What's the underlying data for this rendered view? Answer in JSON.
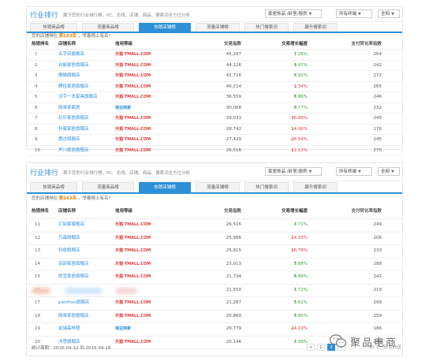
{
  "panel1": {
    "brand": "行业排行",
    "description": "属于您的行业排行榜，PC、无线、店铺、商品、搜索词全方位分析",
    "category_select": "家居饰品 /卧室/厨房",
    "terminal_select": "所有终端",
    "network_select": "全网",
    "tabs": [
      {
        "label": "热销商品榜"
      },
      {
        "label": "流量商品榜"
      },
      {
        "label": "热销店铺榜"
      },
      {
        "label": "流量店铺榜"
      },
      {
        "label": "热门搜索词"
      },
      {
        "label": "飙升搜索词"
      }
    ],
    "rank_line": {
      "prefix": "您的店铺排在",
      "value": "第163名",
      "suffix": "，举着榜上有名?"
    },
    "columns": {
      "rank": "热销排名",
      "shop": "店铺名称",
      "credit": "信用等级",
      "trade": "交易指数",
      "growth": "交易增长幅度",
      "conversion": "支付转化率指数"
    },
    "rows": [
      {
        "rank": "1",
        "shop": "名字店旗舰店",
        "credit": "天猫 TMALL.COM",
        "trade": "45,297",
        "dir": "up",
        "growth": "7.26%",
        "conv": "264"
      },
      {
        "rank": "2",
        "shop": "台能家居旗舰店",
        "credit": "天猫 TMALL.COM",
        "trade": "44,126",
        "dir": "up",
        "growth": "9.97%",
        "conv": "242"
      },
      {
        "rank": "3",
        "shop": "懒猫旗舰店",
        "credit": "天猫 TMALL.COM",
        "trade": "42,716",
        "dir": "up",
        "growth": "0.91%",
        "conv": "272"
      },
      {
        "rank": "4",
        "shop": "腾佳家居旗舰店",
        "credit": "天猫 TMALL.COM",
        "trade": "40,214",
        "dir": "down",
        "growth": "2.34%",
        "conv": "265"
      },
      {
        "rank": "5",
        "shop": "沃宇一本家具旗舰店",
        "credit": "天猫 TMALL.COM",
        "trade": "36,559",
        "dir": "up",
        "growth": "6.86%",
        "conv": "246"
      },
      {
        "rank": "6",
        "shop": "简单家家居",
        "credit": "淘宝商家",
        "trade": "30,068",
        "dir": "up",
        "growth": "0.77%",
        "conv": "232"
      },
      {
        "rank": "7",
        "shop": "幻乐家居旗舰店",
        "credit": "天猫 TMALL.COM",
        "trade": "29,033",
        "dir": "down",
        "growth": "36.88%",
        "conv": "249"
      },
      {
        "rank": "8",
        "shop": "科曼家居旗舰店",
        "credit": "天猫 TMALL.COM",
        "trade": "28,742",
        "dir": "down",
        "growth": "14.06%",
        "conv": "176"
      },
      {
        "rank": "9",
        "shop": "惠达旗舰店",
        "credit": "天猫 TMALL.COM",
        "trade": "27,429",
        "dir": "down",
        "growth": "26.54%",
        "conv": "245"
      },
      {
        "rank": "10",
        "shop": "声川家居旗舰店",
        "credit": "天猫 TMALL.COM",
        "trade": "26,516",
        "dir": "down",
        "growth": "12.13%",
        "conv": "270"
      }
    ]
  },
  "panel2": {
    "brand": "行业排行",
    "description": "属于您的行业排行榜，PC、无线、店铺、商品、搜索词全方位分析",
    "category_select": "家居饰品 /卧室/厨房",
    "terminal_select": "所有终端",
    "network_select": "全网",
    "tabs": [
      {
        "label": "热销商品榜"
      },
      {
        "label": "流量商品榜"
      },
      {
        "label": "热销店铺榜"
      },
      {
        "label": "流量店铺榜"
      },
      {
        "label": "热门搜索词"
      },
      {
        "label": "飙升搜索词"
      }
    ],
    "rank_line": {
      "prefix": "您的店铺排在",
      "value": "第163名",
      "suffix": "，举着榜上有名?"
    },
    "columns": {
      "rank": "热销排名",
      "shop": "店铺名称",
      "credit": "信用等级",
      "trade": "交易指数",
      "growth": "交易增长幅度",
      "conversion": "支付转化率指数"
    },
    "rows": [
      {
        "rank": "11",
        "shop": "汇如家旗舰店",
        "credit": "天猫 TMALL.COM",
        "trade": "26,516",
        "dir": "up",
        "growth": "2.71%",
        "conv": "249"
      },
      {
        "rank": "12",
        "shop": "万森旗舰店",
        "credit": "天猫 TMALL.COM",
        "trade": "25,966",
        "dir": "down",
        "growth": "14.33%",
        "conv": "206"
      },
      {
        "rank": "13",
        "shop": "科居旗舰店",
        "credit": "天猫 TMALL.COM",
        "trade": "25,815",
        "dir": "down",
        "growth": "16.78%",
        "conv": "233"
      },
      {
        "rank": "14",
        "shop": "亚韵家居旗舰店",
        "credit": "天猫 TMALL.COM",
        "trade": "23,013",
        "dir": "up",
        "growth": "5.88%",
        "conv": "188"
      },
      {
        "rank": "15",
        "shop": "附宜家居旗舰店",
        "credit": "天猫 TMALL.COM",
        "trade": "21,734",
        "dir": "up",
        "growth": "6.89%",
        "conv": "242"
      },
      {
        "rank": "16",
        "shop": "",
        "credit": "",
        "trade": "21,550",
        "dir": "up",
        "growth": "1.72%",
        "conv": "219",
        "blurred": true
      },
      {
        "rank": "17",
        "shop": "panthoo旗舰店",
        "credit": "天猫 TMALL.COM",
        "trade": "21,287",
        "dir": "up",
        "growth": "5.61%",
        "conv": "299"
      },
      {
        "rank": "18",
        "shop": "简单家居旗舰店",
        "credit": "天猫 TMALL.COM",
        "trade": "20,869",
        "dir": "up",
        "growth": "9.85%",
        "conv": "259"
      },
      {
        "rank": "19",
        "shop": "金瑞森林馆",
        "credit": "淘宝商家",
        "trade": "20,779",
        "dir": "down",
        "growth": "24.19%",
        "conv": "186"
      },
      {
        "rank": "20",
        "shop": "洋思旗舰店",
        "credit": "天猫 TMALL.COM",
        "trade": "20,146",
        "dir": "up",
        "growth": "2.08%",
        "conv": "244"
      }
    ],
    "footer": {
      "period": "统计周期：2016-04-12 到 2016-04-18",
      "pages": [
        "<",
        "1",
        "2",
        ">"
      ],
      "current_page": "2",
      "total": "10 下一页 共10页"
    }
  },
  "watermark": {
    "text": "聚品电商"
  },
  "colors": {
    "accent": "#2e8fd8",
    "up": "#3aa13a",
    "down": "#e4393c",
    "rank_highlight": "#f08000",
    "tmall_red": "#e4393c"
  }
}
